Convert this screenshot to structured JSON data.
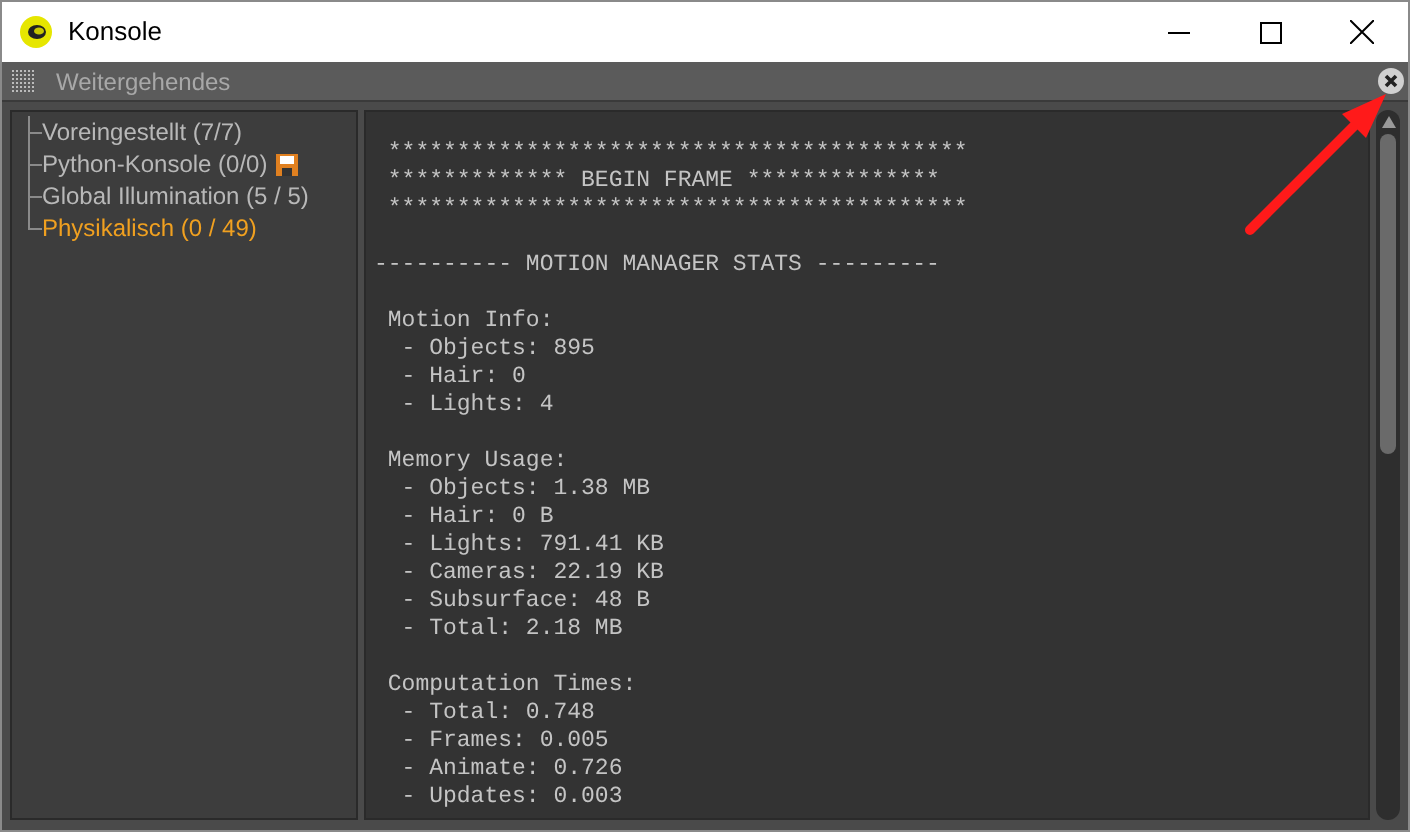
{
  "window": {
    "title": "Konsole"
  },
  "menu_bar": {
    "title": "Weitergehendes"
  },
  "tree": [
    {
      "label": "Voreingestellt (7/7)",
      "selected": false,
      "saved": false
    },
    {
      "label": "Python-Konsole (0/0)",
      "selected": false,
      "saved": true
    },
    {
      "label": "Global Illumination (5 / 5)",
      "selected": false,
      "saved": false
    },
    {
      "label": "Physikalisch (0 / 49)",
      "selected": true,
      "saved": false
    }
  ],
  "console": {
    "blocks": [
      {
        "lines": [
          " ******************************************",
          " ************* BEGIN FRAME **************",
          " ******************************************"
        ]
      },
      {
        "lines": [
          "---------- MOTION MANAGER STATS ---------"
        ]
      },
      {
        "lines": [
          " Motion Info:",
          "  - Objects: 895",
          "  - Hair: 0",
          "  - Lights: 4"
        ]
      },
      {
        "lines": [
          " Memory Usage:",
          "  - Objects: 1.38 MB",
          "  - Hair: 0 B",
          "  - Lights: 791.41 KB",
          "  - Cameras: 22.19 KB",
          "  - Subsurface: 48 B",
          "  - Total: 2.18 MB"
        ]
      },
      {
        "lines": [
          " Computation Times:",
          "  - Total: 0.748",
          "  - Frames: 0.005",
          "  - Animate: 0.726",
          "  - Updates: 0.003"
        ]
      }
    ]
  }
}
